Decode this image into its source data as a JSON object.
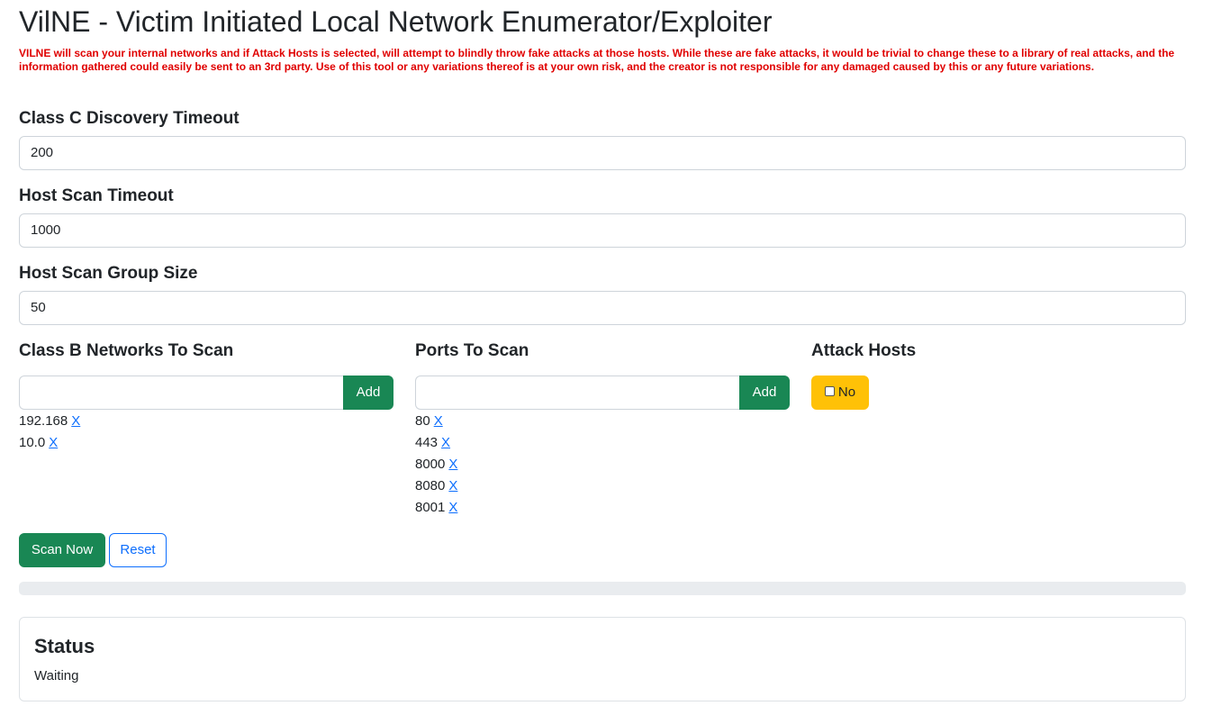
{
  "page": {
    "title": "VilNE - Victim Initiated Local Network Enumerator/Exploiter",
    "warning": "VILNE will scan your internal networks and if Attack Hosts is selected, will attempt to blindly throw fake attacks at those hosts. While these are fake attacks, it would be trivial to change these to a library of real attacks, and the information gathered could easily be sent to an 3rd party. Use of this tool or any variations thereof is at your own risk, and the creator is not responsible for any damaged caused by this or any future variations."
  },
  "form": {
    "class_c_timeout": {
      "label": "Class C Discovery Timeout",
      "value": "200"
    },
    "host_scan_timeout": {
      "label": "Host Scan Timeout",
      "value": "1000"
    },
    "host_scan_group_size": {
      "label": "Host Scan Group Size",
      "value": "50"
    }
  },
  "networks": {
    "label": "Class B Networks To Scan",
    "input_value": "",
    "add_label": "Add",
    "remove_label": "X",
    "items": [
      "192.168",
      "10.0"
    ]
  },
  "ports": {
    "label": "Ports To Scan",
    "input_value": "",
    "add_label": "Add",
    "remove_label": "X",
    "items": [
      "80",
      "443",
      "8000",
      "8080",
      "8001"
    ]
  },
  "attack": {
    "label": "Attack Hosts",
    "toggle_label": "No",
    "checked": false,
    "color": "#ffc107"
  },
  "actions": {
    "scan_label": "Scan Now",
    "reset_label": "Reset"
  },
  "progress": {
    "value": 0
  },
  "status": {
    "title": "Status",
    "text": "Waiting"
  },
  "colors": {
    "success": "#198754",
    "warning_text": "#e00000",
    "link": "#0d6efd"
  }
}
